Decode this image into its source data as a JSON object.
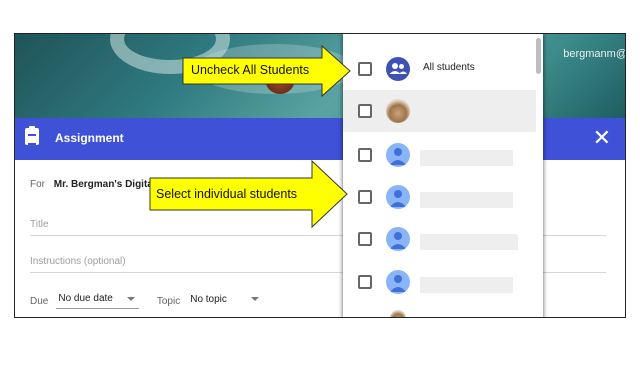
{
  "banner": {
    "user_name": "bergmanm@"
  },
  "header": {
    "title": "Assignment",
    "close_glyph": "✕"
  },
  "form": {
    "for_label": "For",
    "class_name": "Mr. Bergman's Digital C",
    "title_placeholder": "Title",
    "instructions_placeholder": "Instructions (optional)",
    "due_label": "Due",
    "due_value": "No due date",
    "topic_label": "Topic",
    "topic_value": "No topic"
  },
  "dropdown": {
    "all_students_label": "All students",
    "rows": [
      "all-students",
      "photo-student",
      "student",
      "student",
      "student",
      "student"
    ]
  },
  "callouts": {
    "uncheck": "Uncheck All Students",
    "select": "Select individual students"
  },
  "colors": {
    "header": "#3f51d6",
    "callout_fill": "#ffff00",
    "group_avatar": "#3f51b5",
    "person_avatar": "#8ab4f8"
  }
}
